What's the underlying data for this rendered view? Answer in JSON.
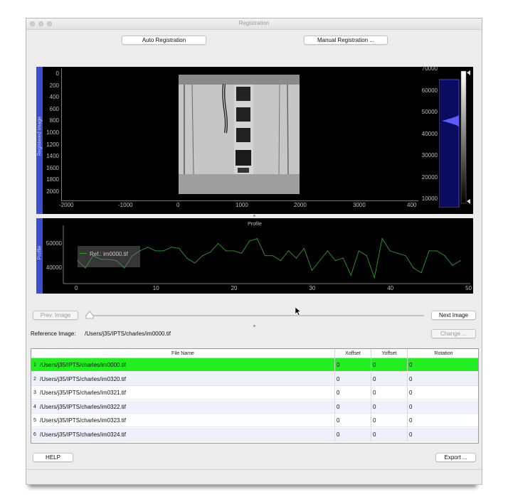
{
  "window": {
    "title": "Registration"
  },
  "toolbar": {
    "auto_label": "Auto Registration",
    "manual_label": "Manual Registration ..."
  },
  "image_panel": {
    "side_label": "Registered Image",
    "y_ticks": [
      "0",
      "200",
      "400",
      "600",
      "800",
      "1000",
      "1200",
      "1400",
      "1600",
      "1800",
      "2000"
    ],
    "x_ticks": [
      "-2000",
      "-1000",
      "0",
      "1000",
      "2000",
      "3000",
      "400"
    ],
    "hist_ticks": [
      "70000",
      "60000",
      "50000",
      "40000",
      "30000",
      "20000",
      "10000"
    ]
  },
  "profile_panel": {
    "side_label": "Profile",
    "title": "Profile",
    "legend": "Ref.: im0000.tif",
    "y_ticks": [
      "50000",
      "40000"
    ],
    "x_ticks": [
      "0",
      "10",
      "20",
      "30",
      "40",
      "50"
    ]
  },
  "chart_data": {
    "type": "line",
    "title": "Profile",
    "legend": [
      "Ref.: im0000.tif"
    ],
    "xlim": [
      -2,
      50
    ],
    "ylim": [
      35000,
      56000
    ],
    "x": [
      0,
      1,
      2,
      3,
      4,
      5,
      6,
      7,
      8,
      9,
      10,
      11,
      12,
      13,
      14,
      15,
      16,
      17,
      18,
      19,
      20,
      21,
      22,
      23,
      24,
      25,
      26,
      27,
      28,
      29,
      30,
      31,
      32,
      33,
      34,
      35,
      36,
      37,
      38,
      39,
      40,
      41,
      42,
      43,
      44,
      45,
      46,
      47,
      48,
      49
    ],
    "series": [
      {
        "name": "Ref.: im0000.tif",
        "color": "#2e9a2e",
        "values": [
          43000,
          40000,
          45000,
          43500,
          43500,
          43000,
          40000,
          45000,
          47000,
          48500,
          47000,
          47000,
          48500,
          48000,
          44000,
          42000,
          45000,
          46500,
          50000,
          47000,
          47000,
          46000,
          51000,
          52000,
          45000,
          45000,
          43000,
          47000,
          44000,
          48000,
          39000,
          43000,
          47000,
          43000,
          44000,
          37000,
          47000,
          45000,
          36000,
          52000,
          47000,
          46000,
          45000,
          40000,
          38000,
          47000,
          47000,
          45000,
          41000,
          43000
        ]
      }
    ]
  },
  "navigation": {
    "prev_label": "Prev. Image",
    "next_label": "Next Image",
    "slider_value": 0
  },
  "reference": {
    "label": "Reference Image:",
    "path": "/Users/j35/IPTS/charles/im0000.tif",
    "change_label": "Change ..."
  },
  "table": {
    "headers": [
      "File Name",
      "Xoffset",
      "Yoffset",
      "Rotation"
    ],
    "rows": [
      {
        "num": "1",
        "file": "/Users/j35/IPTS/charles/im0000.tif",
        "x": "0",
        "y": "0",
        "r": "0"
      },
      {
        "num": "2",
        "file": "/Users/j35/IPTS/charles/im0320.tif",
        "x": "0",
        "y": "0",
        "r": "0"
      },
      {
        "num": "3",
        "file": "/Users/j35/IPTS/charles/im0321.tif",
        "x": "0",
        "y": "0",
        "r": "0"
      },
      {
        "num": "4",
        "file": "/Users/j35/IPTS/charles/im0322.tif",
        "x": "0",
        "y": "0",
        "r": "0"
      },
      {
        "num": "5",
        "file": "/Users/j35/IPTS/charles/im0323.tif",
        "x": "0",
        "y": "0",
        "r": "0"
      },
      {
        "num": "6",
        "file": "/Users/j35/IPTS/charles/im0324.tif",
        "x": "0",
        "y": "0",
        "r": "0"
      }
    ],
    "selected_color": "#22ee22"
  },
  "footer": {
    "help_label": "HELP",
    "export_label": "Export ..."
  }
}
